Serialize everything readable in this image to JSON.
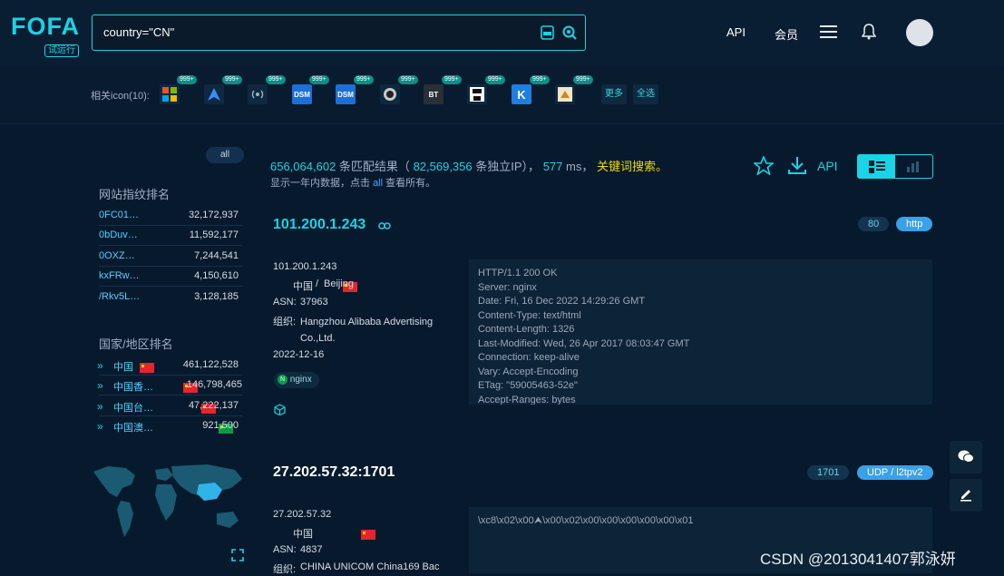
{
  "header": {
    "logo": "FOFA",
    "logo_sub": "试运行",
    "search_value": "country=\"CN\"",
    "nav": {
      "api": "API",
      "member": "会员"
    }
  },
  "icons": {
    "label": "相关icon(10):",
    "badge": "999+",
    "items": [
      {
        "name": "windows-icon",
        "text": ""
      },
      {
        "name": "arrow-logo-icon",
        "text": ""
      },
      {
        "name": "wifi-signal-icon",
        "text": ""
      },
      {
        "name": "dsm-icon",
        "text": "DSM"
      },
      {
        "name": "dsm-icon",
        "text": "DSM"
      },
      {
        "name": "camera-icon",
        "text": ""
      },
      {
        "name": "bt-icon",
        "text": "BT"
      },
      {
        "name": "floppy-icon",
        "text": ""
      },
      {
        "name": "k-logo-icon",
        "text": "K"
      },
      {
        "name": "puzzle-icon",
        "text": ""
      }
    ],
    "more": "更多",
    "select_all": "全选"
  },
  "sidebar": {
    "all": "all",
    "fingerprint_title": "网站指纹排名",
    "fingerprints": [
      {
        "key": "0FC01…",
        "value": "32,172,937"
      },
      {
        "key": "0bDuv…",
        "value": "11,592,177"
      },
      {
        "key": "0OXZ…",
        "value": "7,244,541"
      },
      {
        "key": "kxFRw…",
        "value": "4,150,610"
      },
      {
        "key": "/Rkv5L…",
        "value": "3,128,185"
      }
    ],
    "country_title": "国家/地区排名",
    "countries": [
      {
        "name": "中国",
        "value": "461,122,528"
      },
      {
        "name": "中国香…",
        "value": "146,798,465"
      },
      {
        "name": "中国台…",
        "value": "47,222,137"
      },
      {
        "name": "中国澳…",
        "value": "921,500"
      }
    ]
  },
  "summary": {
    "total": "656,064,602",
    "match_text": "条匹配结果（",
    "unique": "82,569,356",
    "unique_text": "条独立IP），",
    "ms": "577",
    "ms_text": "ms，",
    "keyword": "关键词搜索。",
    "note_prefix": "显示一年内数据，点击",
    "note_all": "all",
    "note_suffix": "查看所有。",
    "api": "API"
  },
  "results": [
    {
      "title": "101.200.1.243",
      "port": "80",
      "protocol": "http",
      "ip": "101.200.1.243",
      "country": "中国",
      "sep": "/",
      "city": "Beijing",
      "asn_label": "ASN:",
      "asn": "37963",
      "org_label": "组织:",
      "org": "Hangzhou Alibaba Advertising Co.,Ltd.",
      "date": "2022-12-16",
      "tag": "nginx",
      "banner": [
        "HTTP/1.1 200 OK",
        "Server: nginx",
        "Date: Fri, 16 Dec 2022 14:29:26 GMT",
        "Content-Type: text/html",
        "Content-Length: 1326",
        "Last-Modified: Wed, 26 Apr 2017 08:03:47 GMT",
        "Connection: keep-alive",
        "Vary: Accept-Encoding",
        "ETag: \"59005463-52e\"",
        "Accept-Ranges: bytes"
      ]
    },
    {
      "title": "27.202.57.32:1701",
      "port": "1701",
      "protocol": "UDP / l2tpv2",
      "ip": "27.202.57.32",
      "country": "中国",
      "asn_label": "ASN:",
      "asn": "4837",
      "org_label": "组织:",
      "org": "CHINA UNICOM China169 Bac",
      "banner": [
        "\\xc8\\x02\\x00⮝\\x00\\x02\\x00\\x00\\x00\\x00\\x00\\x01"
      ]
    }
  ],
  "watermark": "CSDN @2013041407郭泳妍",
  "colors": {
    "accent": "#19d3e6",
    "link": "#4fa5ff",
    "keyword": "#f5d800",
    "bg": "#071a2d"
  }
}
